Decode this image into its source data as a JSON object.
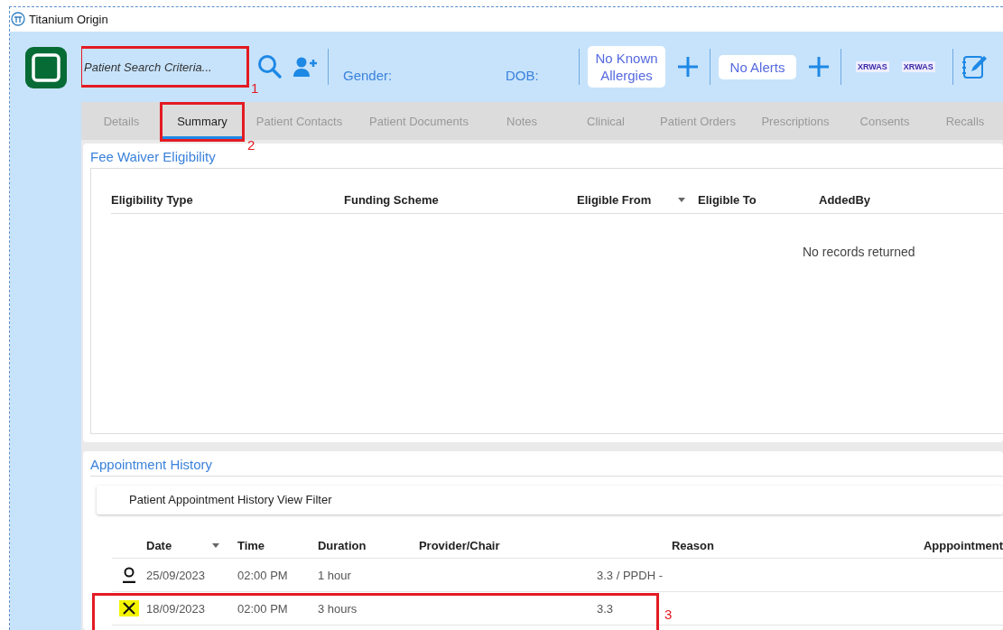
{
  "window": {
    "title": "Titanium Origin"
  },
  "header": {
    "search": {
      "placeholder": "Patient Search Criteria...",
      "annotation": "1"
    },
    "gender_label": "Gender:",
    "dob_label": "DOB:",
    "allergies": "No Known Allergies",
    "alerts": "No Alerts",
    "badges": [
      "XRWAS",
      "XRWAS"
    ]
  },
  "tabs": [
    {
      "label": "Details",
      "selected": false
    },
    {
      "label": "Summary",
      "selected": true,
      "annotation": "2"
    },
    {
      "label": "Patient Contacts",
      "selected": false
    },
    {
      "label": "Patient Documents",
      "selected": false
    },
    {
      "label": "Notes",
      "selected": false
    },
    {
      "label": "Clinical",
      "selected": false
    },
    {
      "label": "Patient Orders",
      "selected": false
    },
    {
      "label": "Prescriptions",
      "selected": false
    },
    {
      "label": "Consents",
      "selected": false
    },
    {
      "label": "Recalls",
      "selected": false
    }
  ],
  "fee_waiver": {
    "title": "Fee Waiver Eligibility",
    "columns": [
      "Eligibility Type",
      "Funding Scheme",
      "Eligible From",
      "Eligible To",
      "AddedBy"
    ],
    "empty_message": "No records returned"
  },
  "appointments": {
    "title": "Appointment History",
    "filter": "Patient Appointment History View Filter",
    "columns": [
      "Date",
      "Time",
      "Duration",
      "Provider/Chair",
      "Reason",
      "Apppointment"
    ],
    "rows": [
      {
        "kind": "attended",
        "date": "25/09/2023",
        "time": "02:00 PM",
        "duration": "1 hour",
        "provider": "3.3 / PPDH -"
      },
      {
        "kind": "cancelled",
        "date": "18/09/2023",
        "time": "02:00 PM",
        "duration": "3 hours",
        "provider": "3.3",
        "annotation": "3"
      }
    ]
  }
}
